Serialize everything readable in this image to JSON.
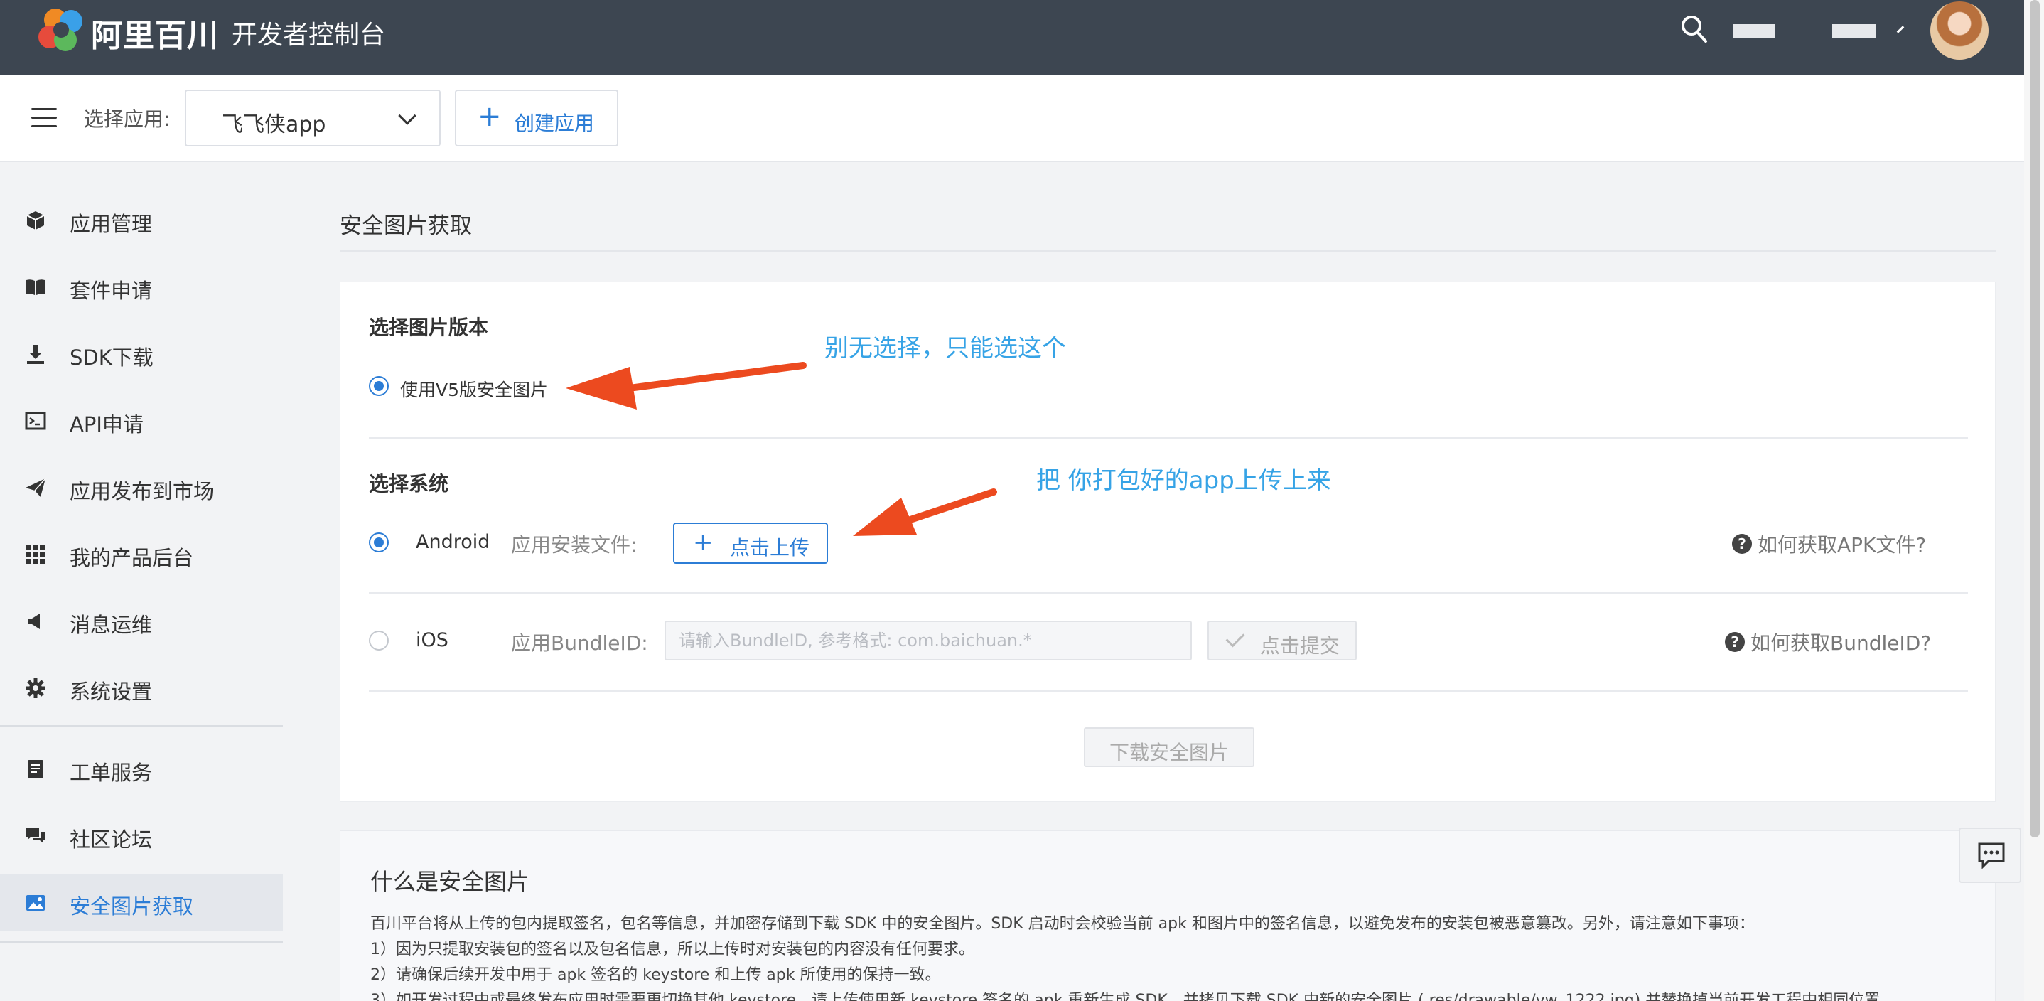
{
  "header": {
    "brand": "阿里百川",
    "console_title": "开发者控制台",
    "icons": [
      "search-icon",
      "avatar"
    ]
  },
  "app_bar": {
    "select_label": "选择应用:",
    "selected_app": "飞飞侠app",
    "create_app": "创建应用"
  },
  "sidebar": {
    "items": [
      {
        "label": "应用管理",
        "icon": "cube-icon"
      },
      {
        "label": "套件申请",
        "icon": "book-icon"
      },
      {
        "label": "SDK下载",
        "icon": "download-icon"
      },
      {
        "label": "API申请",
        "icon": "terminal-icon"
      },
      {
        "label": "应用发布到市场",
        "icon": "paper-plane-icon"
      },
      {
        "label": "我的产品后台",
        "icon": "grid-icon"
      },
      {
        "label": "消息运维",
        "icon": "megaphone-icon"
      },
      {
        "label": "系统设置",
        "icon": "gear-icon"
      },
      {
        "label": "工单服务",
        "icon": "document-icon"
      },
      {
        "label": "社区论坛",
        "icon": "chat-icon"
      },
      {
        "label": "安全图片获取",
        "icon": "image-icon",
        "active": true
      }
    ]
  },
  "page": {
    "title": "安全图片获取"
  },
  "form": {
    "version_section": "选择图片版本",
    "version_option": "使用V5版安全图片",
    "system_section": "选择系统",
    "android_label": "Android",
    "android_file_label": "应用安装文件:",
    "upload_button": "点击上传",
    "apk_help": "如何获取APK文件?",
    "ios_label": "iOS",
    "bundle_label": "应用BundleID:",
    "bundle_placeholder": "请输入BundleID, 参考格式: com.baichuan.*",
    "submit_button": "点击提交",
    "bundle_help": "如何获取BundleID?",
    "download_button": "下载安全图片"
  },
  "annotations": {
    "note_1": "别无选择，只能选这个",
    "note_2": "把 你打包好的app上传上来",
    "color": "#36a3e6",
    "arrow_color": "#ec4a1f"
  },
  "info": {
    "title": "什么是安全图片",
    "intro": "百川平台将从上传的包内提取签名，包名等信息，并加密存储到下载 SDK 中的安全图片。SDK 启动时会校验当前 apk 和图片中的签名信息，以避免发布的安装包被恶意篡改。另外，请注意如下事项：",
    "item_1": "1）因为只提取安装包的签名以及包名信息，所以上传时对安装包的内容没有任何要求。",
    "item_2": "2）请确保后续开发中用于 apk 签名的 keystore 和上传 apk 所使用的保持一致。",
    "item_3": "3）如开发过程中或最终发布应用时需要更切换其他 keystore，请上传使用新 keystore 签名的 apk 重新生成 SDK，并拷贝下载 SDK 中新的安全图片 ( res/drawable/yw_1222.jpg) 并替换掉当前开发工程中相同位置"
  },
  "colors": {
    "topbar": "#3d4651",
    "accent": "#2c7dd6"
  }
}
